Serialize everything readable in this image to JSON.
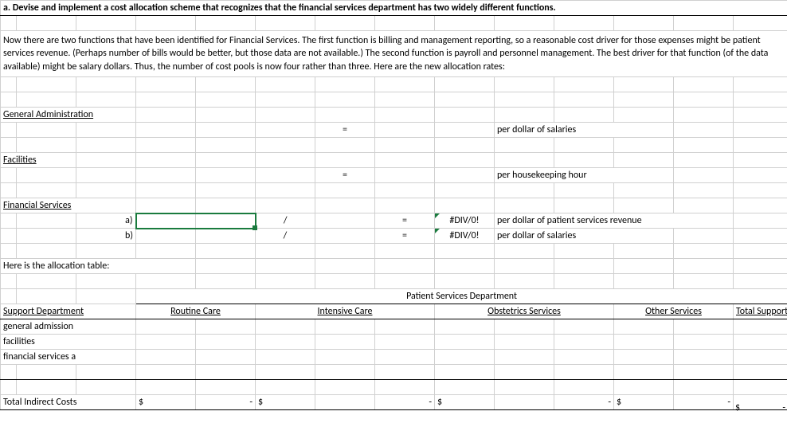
{
  "title": "a.  Devise and implement a cost allocation scheme that recognizes that the financial services department has two widely different functions.",
  "paragraph": "Now there are two functions that have been identified for Financial Services. The first function is billing and management reporting, so a reasonable cost driver for those expenses might be patient services revenue. (Perhaps number of bills would be better, but those data are not available.) The second function is payroll and personnel management. The best driver for that function (of the data available) might be salary dollars. Thus, the number of cost pools is now four rather than three. Here are the new allocation rates:",
  "sections": {
    "gen_admin": "General Administration",
    "facilities": "Facilities",
    "fin_serv": "Financial Services"
  },
  "rates": {
    "eq": "=",
    "slash": "/",
    "per_salaries": "per dollar of salaries",
    "per_hour": "per housekeeping hour",
    "label_a": "a)",
    "label_b": "b)",
    "err": "#DIV/0!",
    "per_psr": "per dollar of patient services revenue"
  },
  "alloc": {
    "intro": "Here is the allocation table:",
    "header": "Patient Services Department",
    "cols": {
      "support": "Support Department",
      "routine": "Routine Care",
      "intensive": "Intensive Care",
      "obstetrics": "Obstetrics Services",
      "other": "Other Services",
      "total": "Total Support Costs"
    },
    "rows": {
      "ga": "general admission",
      "fac": "facilities",
      "fsa": "financial services a"
    },
    "total_label": "Total Indirect Costs",
    "dollar": "$",
    "dash": "-"
  }
}
